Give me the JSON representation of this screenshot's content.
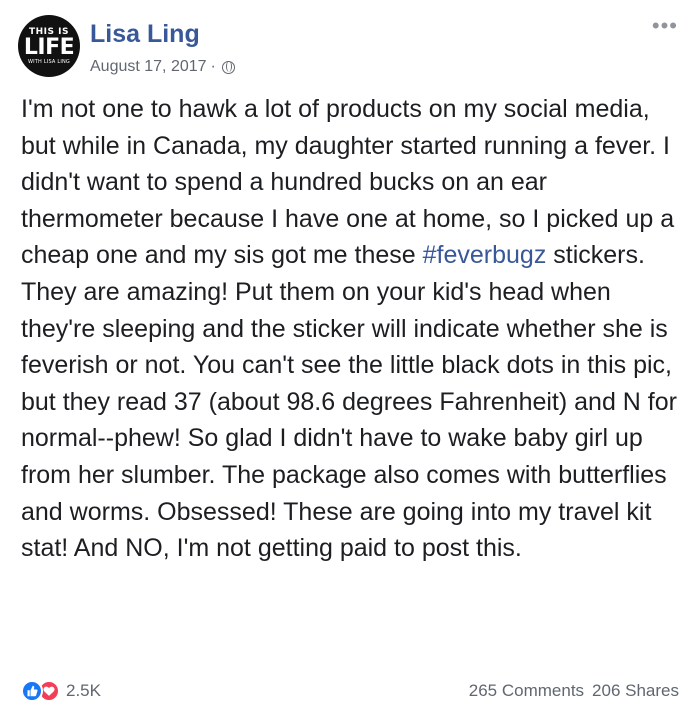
{
  "author": {
    "name": "Lisa Ling",
    "avatar_logo": {
      "top": "THIS IS",
      "main": "LIFE",
      "sub": "WITH LISA LING"
    }
  },
  "meta": {
    "date": "August 17, 2017",
    "separator": "·",
    "privacy_icon": "globe-icon"
  },
  "post": {
    "text_before_hashtag": "I'm not one to hawk a lot of products on my social media, but while in Canada, my daughter started running a fever. I didn't want to spend a hundred bucks on an ear thermometer because I have one at home, so I picked up a cheap one and my sis got me these ",
    "hashtag": "#feverbugz",
    "text_after_hashtag": " stickers. They are amazing! Put them on your kid's head when they're sleeping and the sticker will indicate whether she is feverish or not. You can't see the little black dots in this pic, but they read 37 (about 98.6 degrees Fahrenheit) and N for normal--phew! So glad I didn't have to wake baby girl up from her slumber. The package also comes with butterflies and worms. Obsessed! These are going into my travel kit stat! And NO, I'm not getting paid to post this."
  },
  "footer": {
    "reaction_icons": [
      "like-icon",
      "love-icon"
    ],
    "reaction_count": "2.5K",
    "comments": "265 Comments",
    "shares": "206 Shares"
  },
  "colors": {
    "link": "#385898",
    "secondary_text": "#616770",
    "like": "#1877f2",
    "love": "#f33e58"
  }
}
